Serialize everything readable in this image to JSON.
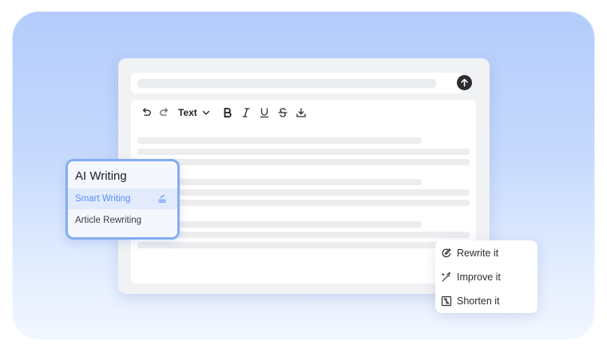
{
  "toolbar": {
    "text_style_label": "Text"
  },
  "ai_panel": {
    "title": "AI Writing",
    "items": [
      {
        "label": "Smart Writing",
        "active": true
      },
      {
        "label": "Article Rewriting",
        "active": false
      }
    ]
  },
  "action_menu": {
    "items": [
      {
        "label": "Rewrite it",
        "icon": "rewrite-icon"
      },
      {
        "label": "Improve it",
        "icon": "magic-wand-icon"
      },
      {
        "label": "Shorten it",
        "icon": "shorten-icon"
      }
    ]
  },
  "colors": {
    "accent": "#5a8ef1",
    "panel_border": "#86acf3",
    "send_button": "#2b2d30"
  }
}
